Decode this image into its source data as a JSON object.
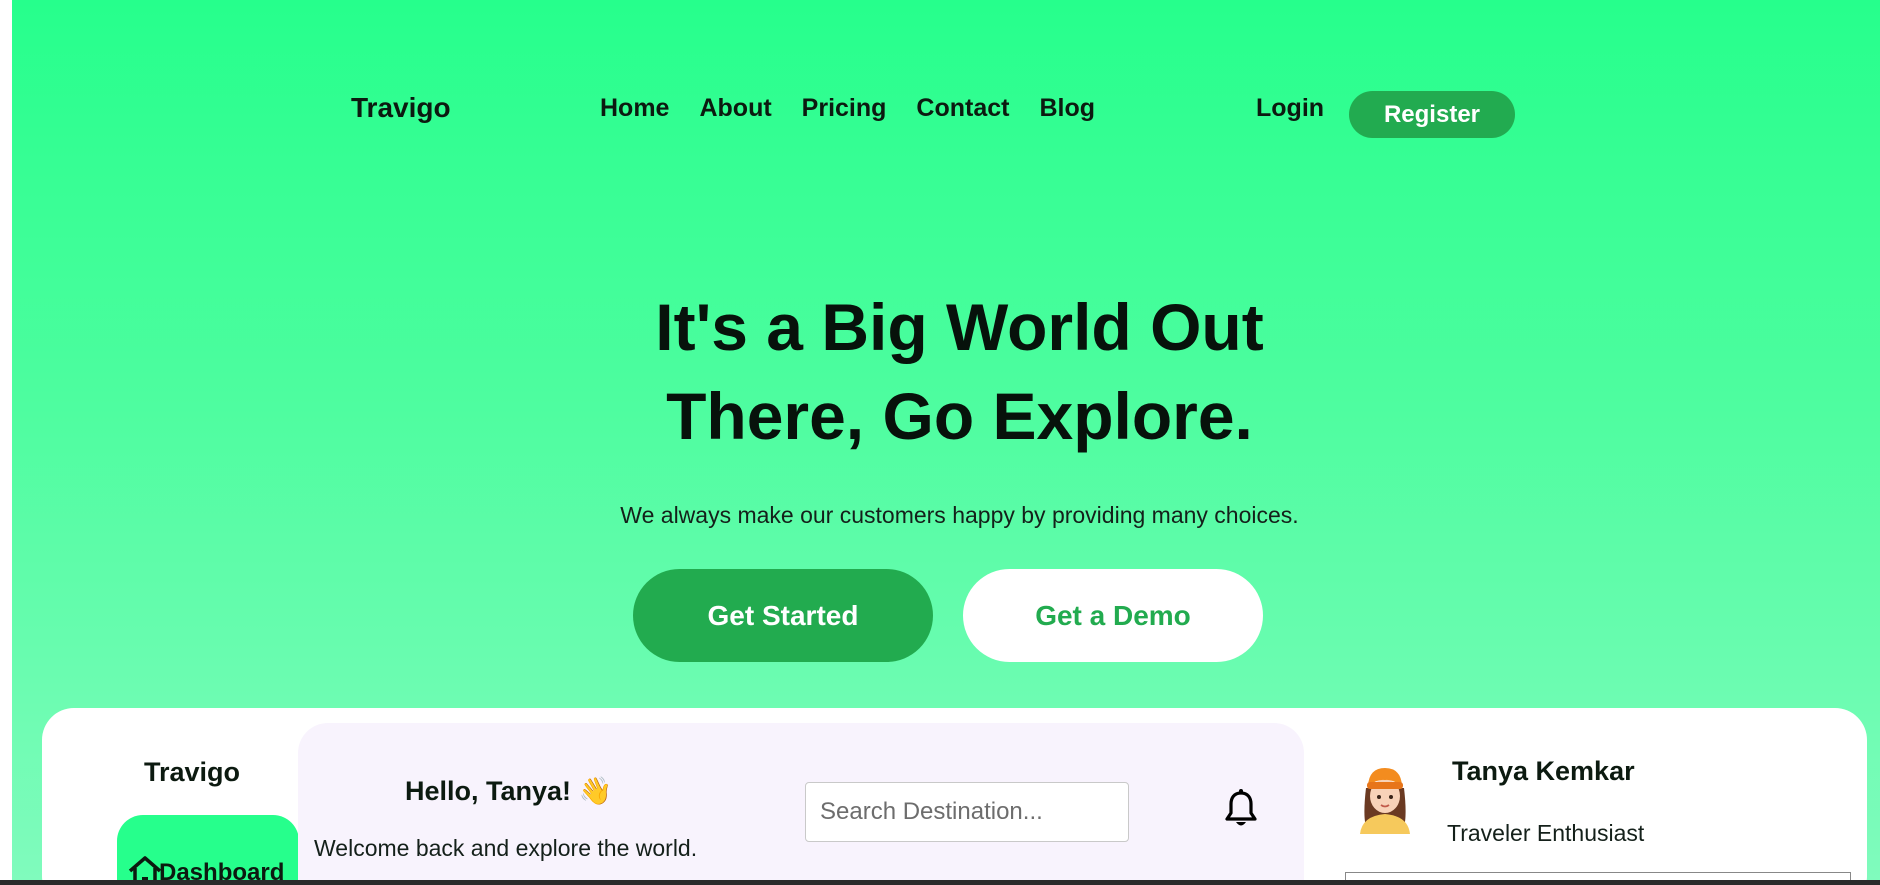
{
  "nav": {
    "brand": "Travigo",
    "links": [
      "Home",
      "About",
      "Pricing",
      "Contact",
      "Blog"
    ],
    "login": "Login",
    "register": "Register"
  },
  "hero": {
    "title_line1": "It's a Big World Out",
    "title_line2": "There, Go Explore.",
    "subtitle": "We always make our customers happy by providing many choices.",
    "primary_cta": "Get Started",
    "secondary_cta": "Get a Demo"
  },
  "dashboard": {
    "brand": "Travigo",
    "sidebar_active": {
      "label": "Dashboard",
      "icon": "home-icon"
    },
    "greeting": "Hello, Tanya!",
    "greeting_emoji": "👋",
    "welcome": "Welcome back and explore the world.",
    "search_placeholder": "Search Destination...",
    "notification_icon": "bell-icon",
    "profile": {
      "name": "Tanya Kemkar",
      "role": "Traveler Enthusiast"
    }
  },
  "colors": {
    "gradient_top": "#26ff8c",
    "gradient_bottom": "#80fbbd",
    "accent_green": "#22ab4f",
    "panel_bg": "#f8f3fd"
  }
}
